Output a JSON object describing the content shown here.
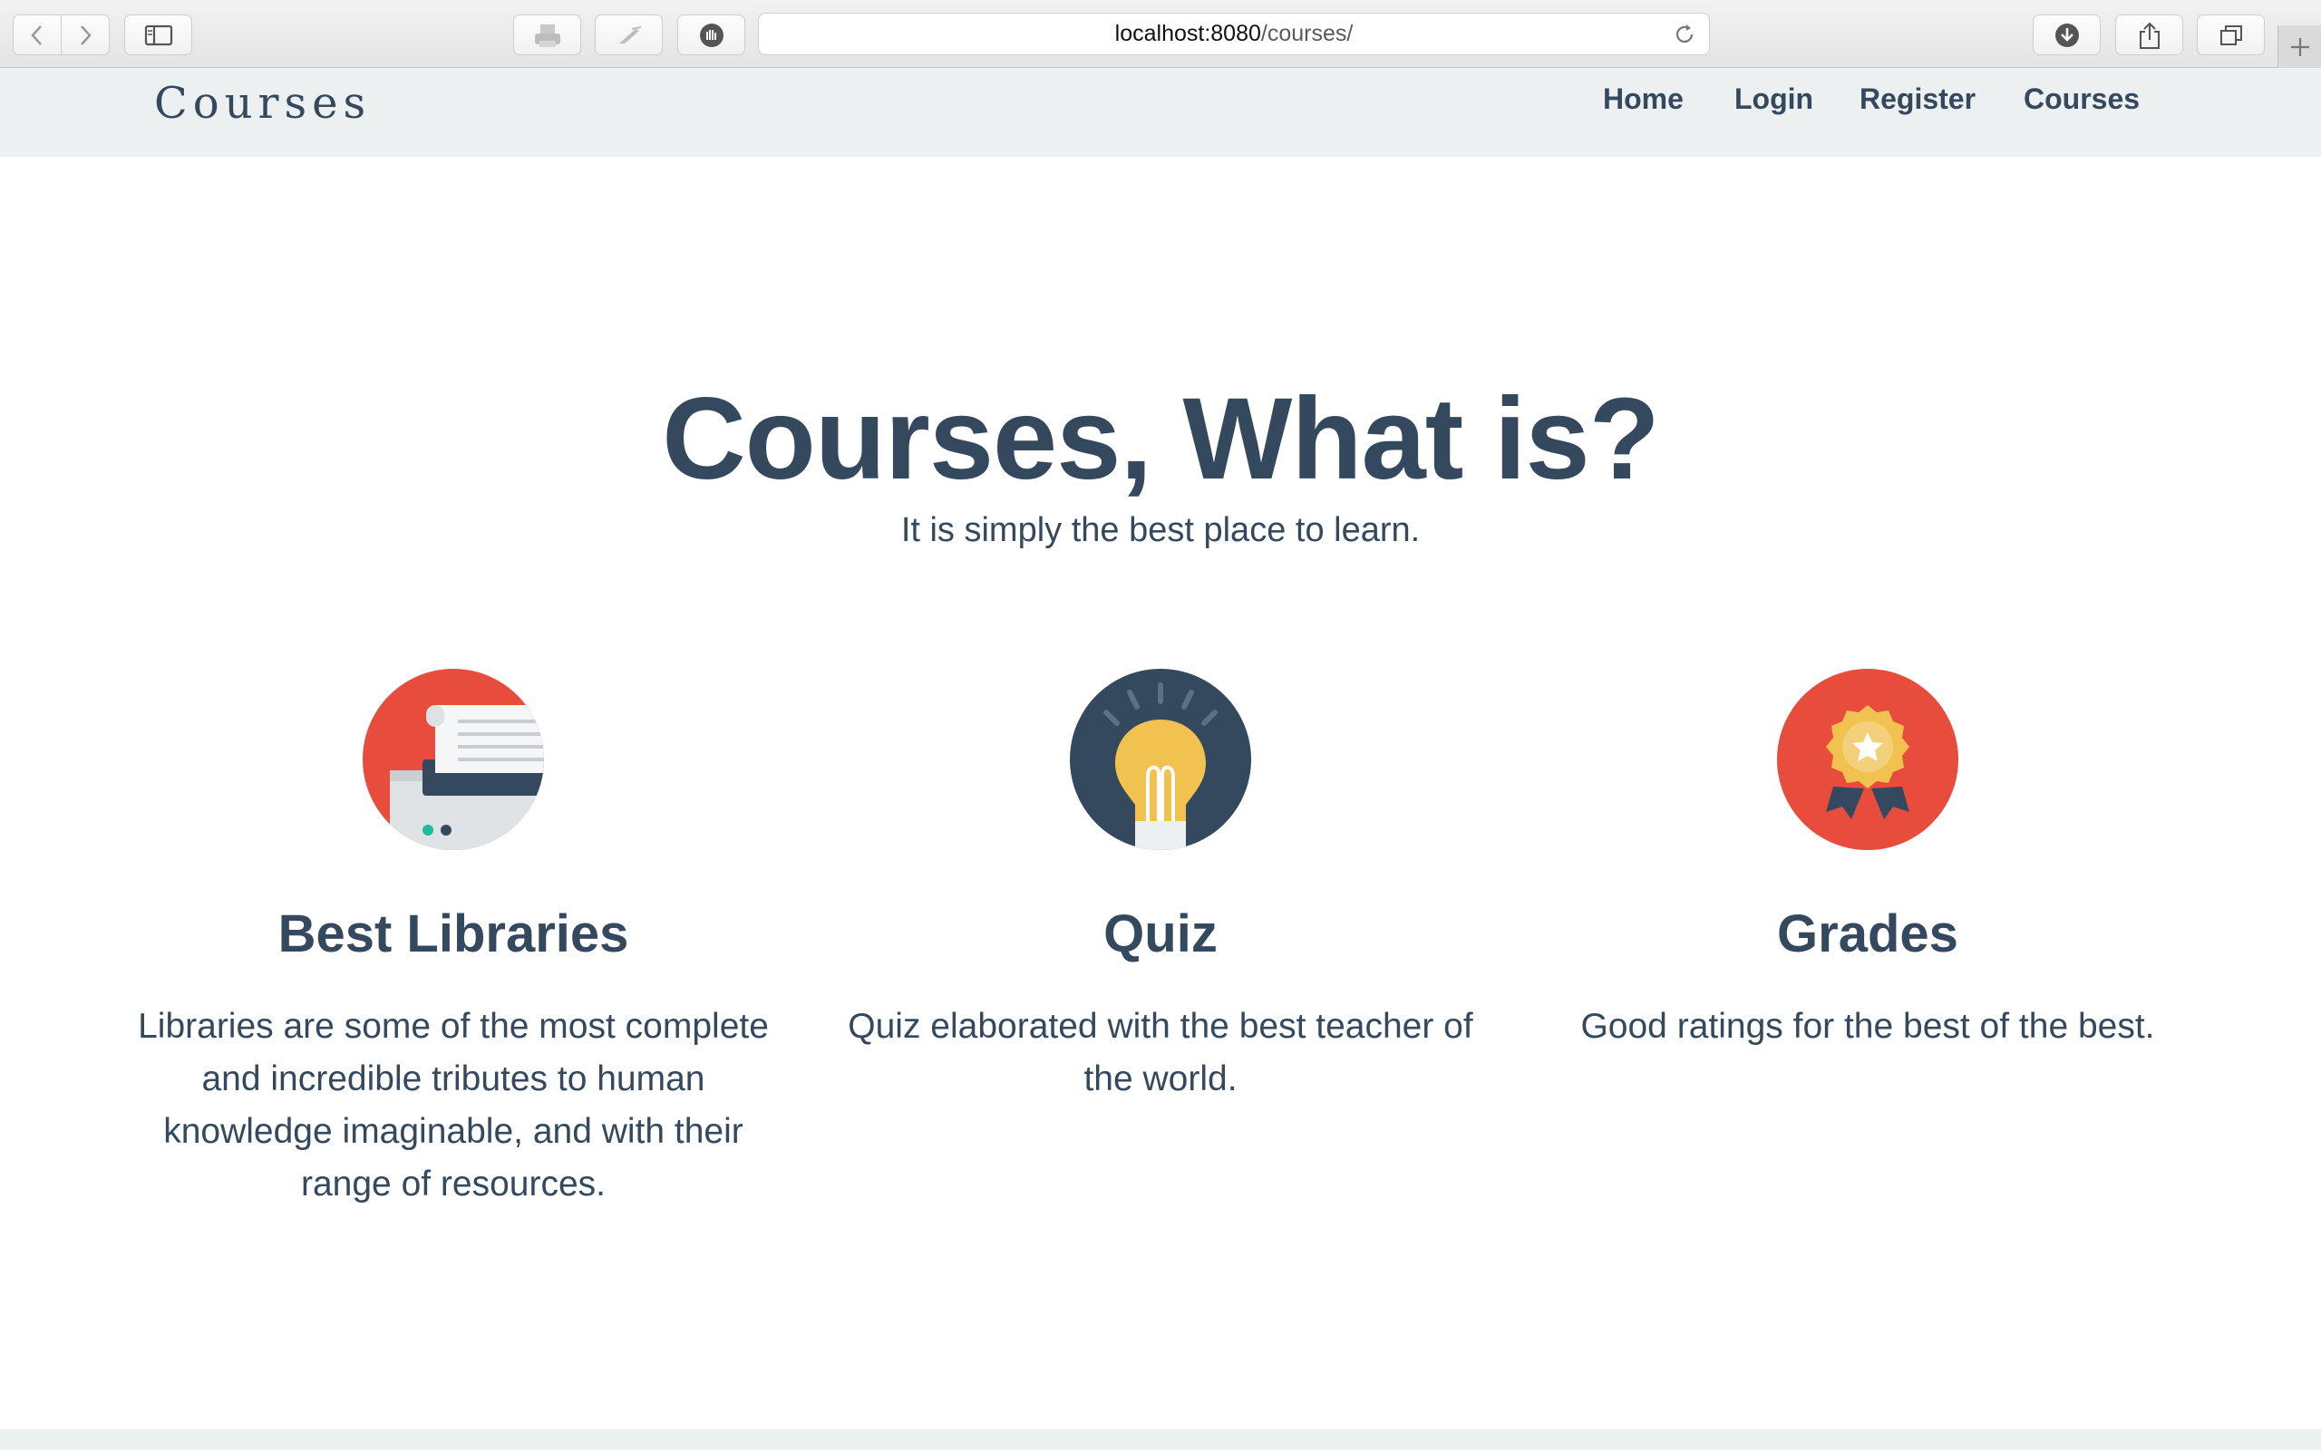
{
  "browser": {
    "url_host": "localhost:8080",
    "url_path": "/courses/",
    "icons": [
      "back-icon",
      "forward-icon",
      "sidebar-icon",
      "printer-icon",
      "pen-icon",
      "extension-icon",
      "reload-icon",
      "download-icon",
      "share-icon",
      "tabs-icon",
      "new-tab-icon"
    ]
  },
  "navbar": {
    "brand": "Courses",
    "links": [
      "Home",
      "Login",
      "Register",
      "Courses"
    ]
  },
  "hero": {
    "title": "Courses, What is?",
    "subtitle": "It is simply the best place to learn."
  },
  "features": [
    {
      "icon": "printer-document-icon",
      "title": "Best Libraries",
      "text": "Libraries are some of the most complete and incredible tributes to human knowledge imaginable, and with their range of resources."
    },
    {
      "icon": "lightbulb-icon",
      "title": "Quiz",
      "text": "Quiz elaborated with the best teacher of the world."
    },
    {
      "icon": "award-medal-icon",
      "title": "Grades",
      "text": "Good ratings for the best of the best."
    }
  ],
  "colors": {
    "primary": "#34495e",
    "navbar_bg": "#ecf0f1",
    "red": "#e74c3c",
    "yellow": "#f1c40f",
    "dark": "#2c3e50"
  }
}
